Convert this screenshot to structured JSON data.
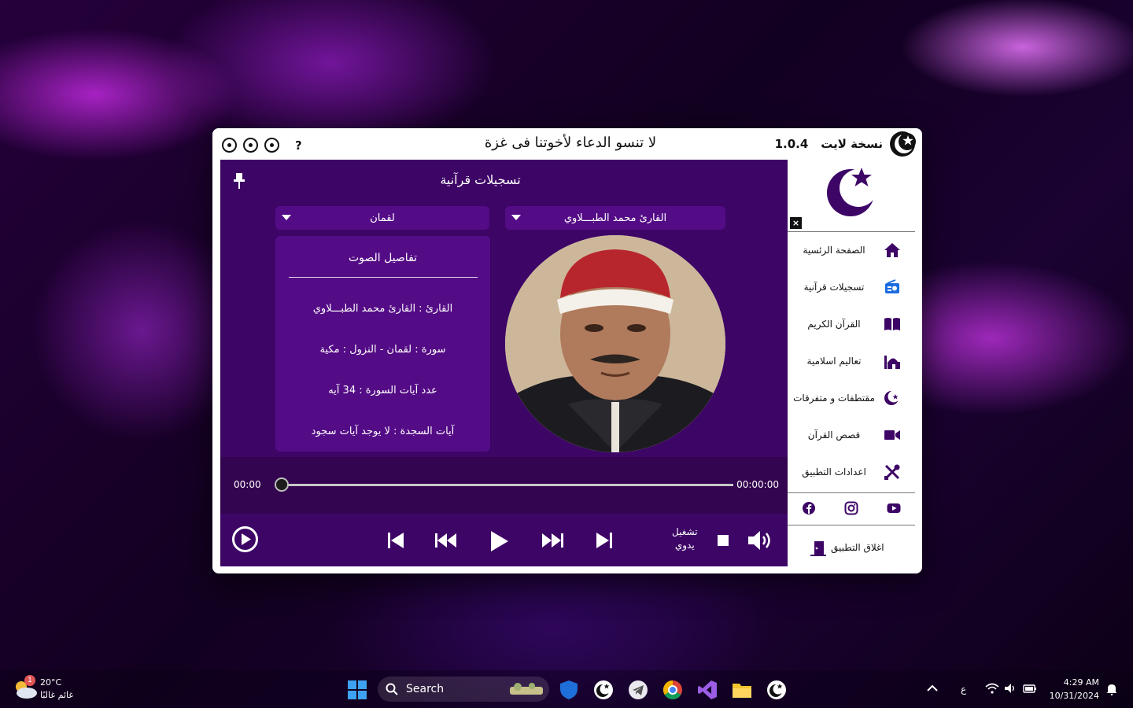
{
  "app": {
    "name": "نسخة لايت",
    "version": "1.0.4",
    "banner": "لا تنسو الدعاء لأخوتنا فى غزة",
    "help_label": "?",
    "accent_color": "#3d0566",
    "panel_color": "#540c86"
  },
  "page": {
    "title": "تسجيلات قرآنية"
  },
  "selectors": {
    "reciter": "القارئ محمد الطبـــلاوي",
    "surah": "لقمان"
  },
  "details": {
    "heading": "تفاصيل الصوت",
    "reciter_line": "القارئ : القارئ محمد الطبـــلاوي",
    "surah_line": "سورة  :  لقمان  -  النزول  :  مكية",
    "ayat_count_line": "عدد آيات السورة :  34  آيه",
    "sajda_line": "آيات السجدة  :  لا يوجد آيات سجود"
  },
  "player": {
    "elapsed": "00:00",
    "duration": "00:00:00",
    "progress": 0,
    "mode_line1": "تشغيل",
    "mode_line2": "يدوي"
  },
  "sidebar": {
    "close_label": "×",
    "items": [
      {
        "label": "الصفحة الرئسية",
        "icon": "home-icon"
      },
      {
        "label": "تسجيلات قرآنية",
        "icon": "radio-icon"
      },
      {
        "label": "القرآن الكريم",
        "icon": "book-icon"
      },
      {
        "label": "تعاليم اسلامية",
        "icon": "mosque-icon"
      },
      {
        "label": "مقتطفات و متفرقات",
        "icon": "crescent-icon"
      },
      {
        "label": "قصص القرآن",
        "icon": "video-icon"
      },
      {
        "label": "اعدادات التطبيق",
        "icon": "tools-icon"
      }
    ],
    "exit_label": "اغلاق التطبيق"
  },
  "taskbar": {
    "search_label": "Search",
    "weather_temp": "20°C",
    "weather_desc": "غائم غالبًا",
    "weather_badge": "1",
    "lang": "ع",
    "time": "4:29 AM",
    "date": "10/31/2024"
  }
}
